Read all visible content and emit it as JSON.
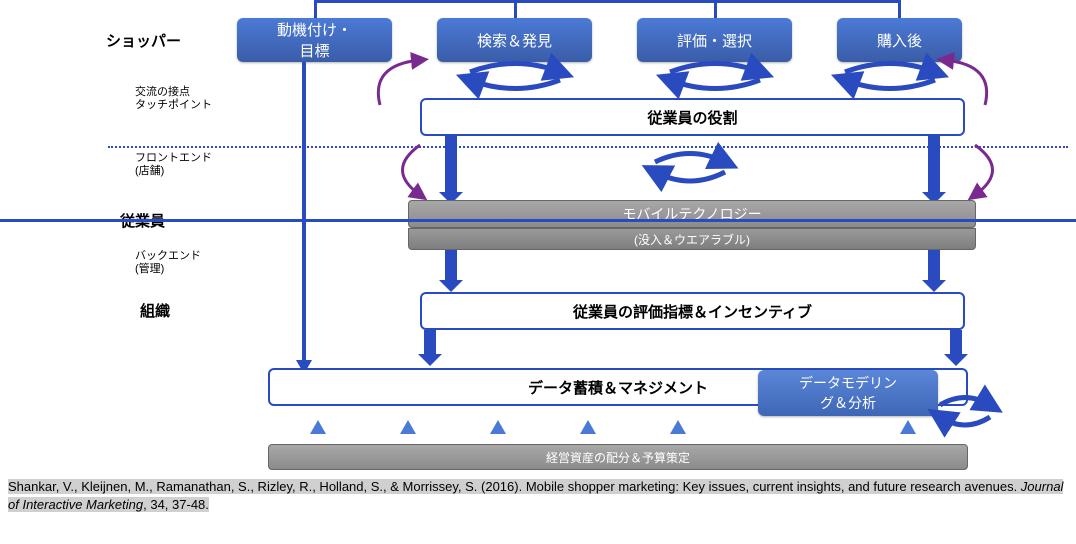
{
  "rows": {
    "shopper": "ショッパー",
    "touchpoint": "交流の接点\nタッチポイント",
    "frontend": "フロントエンド\n(店舗)",
    "employee": "従業員",
    "backend": "バックエンド\n(管理)",
    "org": "組織"
  },
  "stages": {
    "motivation": "動機付け・\n目標",
    "search": "検索＆発見",
    "evaluate": "評価・選択",
    "post": "購入後"
  },
  "boxes": {
    "emp_role": "従業員の役割",
    "mobile_tech": "モバイルテクノロジー",
    "mobile_sub": "(没入＆ウエアラブル)",
    "incentive": "従業員の評価指標＆インセンティブ",
    "data_mgmt": "データ蓄積＆マネジメント",
    "modeling": "データモデリン\nグ＆分析",
    "resource": "経営資産の配分＆予算策定"
  },
  "citation": {
    "authors": "Shankar, V., Kleijnen, M., Ramanathan, S., Rizley, R., Holland, S., & Morrissey, S. (2016). Mobile shopper marketing: Key issues, current insights, and future research avenues. ",
    "journal": "Journal of Interactive Marketing",
    "rest": ", 34, 37-48."
  }
}
